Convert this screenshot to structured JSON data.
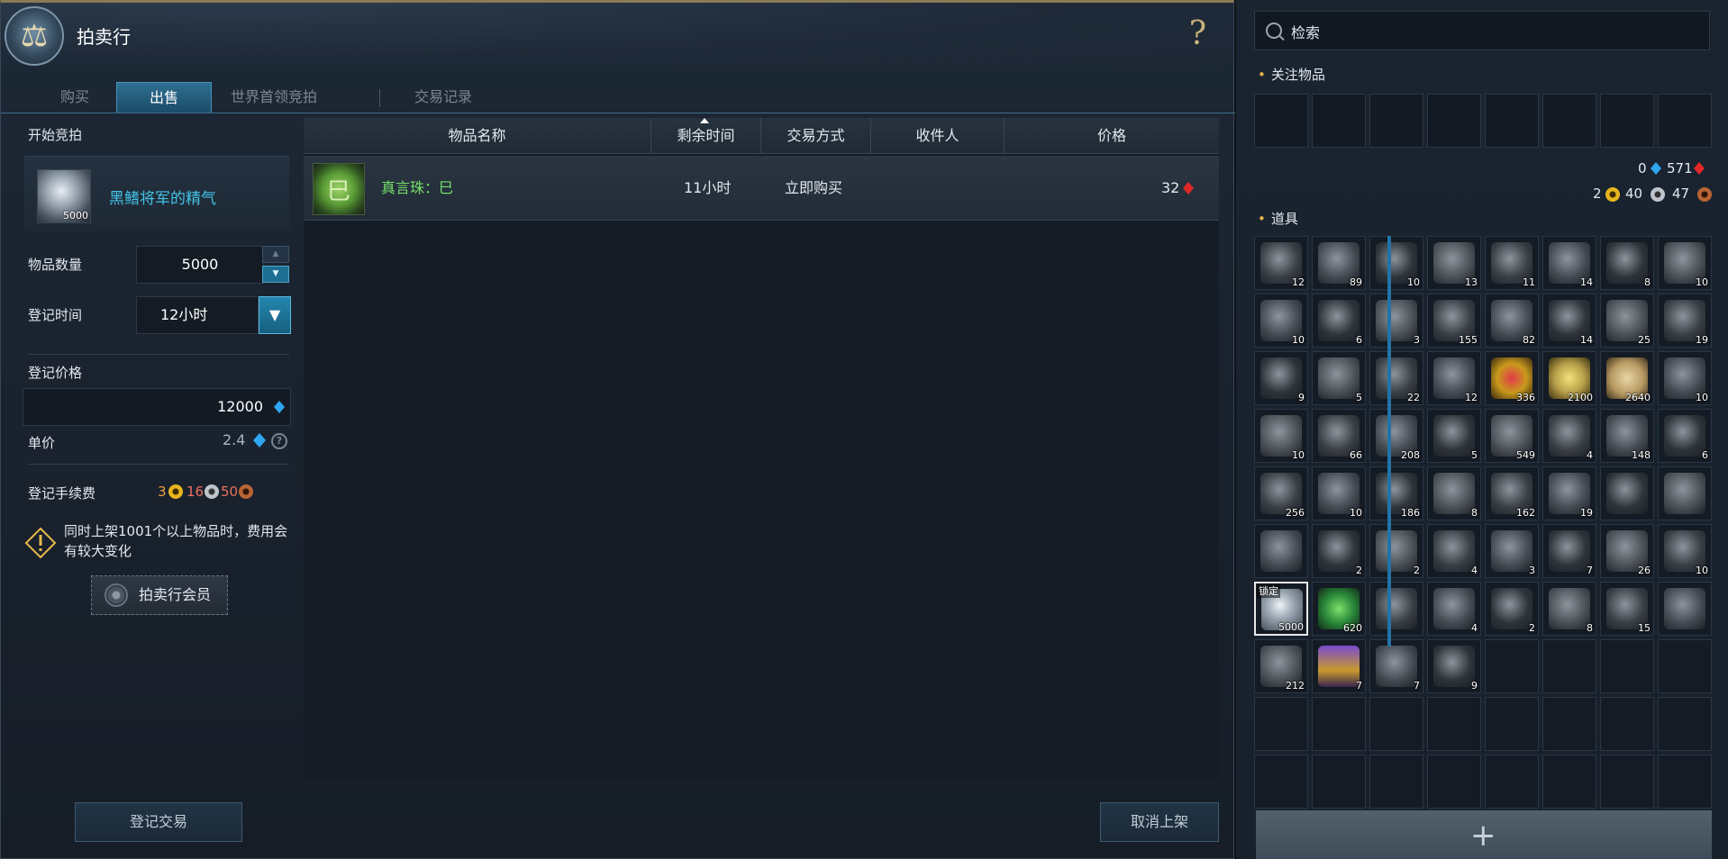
{
  "window": {
    "title": "拍卖行",
    "help": "?"
  },
  "tabs": [
    "购买",
    "出售",
    "世界首领竞拍",
    "交易记录"
  ],
  "sell": {
    "section_title": "开始竞拍",
    "item": {
      "name": "黑鳍将军的精气",
      "count": "5000"
    },
    "qty_label": "物品数量",
    "qty_value": "5000",
    "time_label": "登记时间",
    "time_value": "12小时",
    "price_label": "登记价格",
    "price_value": "12000",
    "unit_label": "单价",
    "unit_value": "2.4",
    "fee_label": "登记手续费",
    "fee_gold": "3",
    "fee_silver": "16",
    "fee_copper": "50",
    "warning": "同时上架1001个以上物品时，费用会有较大变化",
    "member_button": "拍卖行会员",
    "register_button": "登记交易",
    "cancel_button": "取消上架"
  },
  "table": {
    "headers": [
      "物品名称",
      "剩余时间",
      "交易方式",
      "收件人",
      "价格"
    ],
    "rows": [
      {
        "name": "真言珠：巳",
        "time": "11小时",
        "method": "立即购买",
        "recipient": "",
        "price": "32"
      }
    ]
  },
  "inventory": {
    "search_placeholder": "检索",
    "fav_title": "关注物品",
    "items_title": "道具",
    "currency": {
      "blue_gem": "0",
      "red_gem": "571",
      "gold": "2",
      "silver": "40",
      "copper": "47"
    },
    "lock_label": "锁定",
    "counts": [
      [
        "12",
        "89",
        "10",
        "13",
        "11",
        "14",
        "8",
        "10"
      ],
      [
        "10",
        "6",
        "3",
        "155",
        "82",
        "14",
        "25",
        "19"
      ],
      [
        "9",
        "5",
        "22",
        "12",
        "336",
        "2100",
        "2640",
        "10"
      ],
      [
        "10",
        "66",
        "208",
        "5",
        "549",
        "4",
        "148",
        "6"
      ],
      [
        "256",
        "10",
        "186",
        "8",
        "162",
        "19",
        "",
        ""
      ],
      [
        "",
        "2",
        "2",
        "4",
        "3",
        "7",
        "26",
        "10"
      ],
      [
        "5000",
        "620",
        "",
        "4",
        "2",
        "8",
        "15",
        ""
      ],
      [
        "212",
        "7",
        "7",
        "9",
        "",
        "",
        "",
        ""
      ]
    ]
  }
}
